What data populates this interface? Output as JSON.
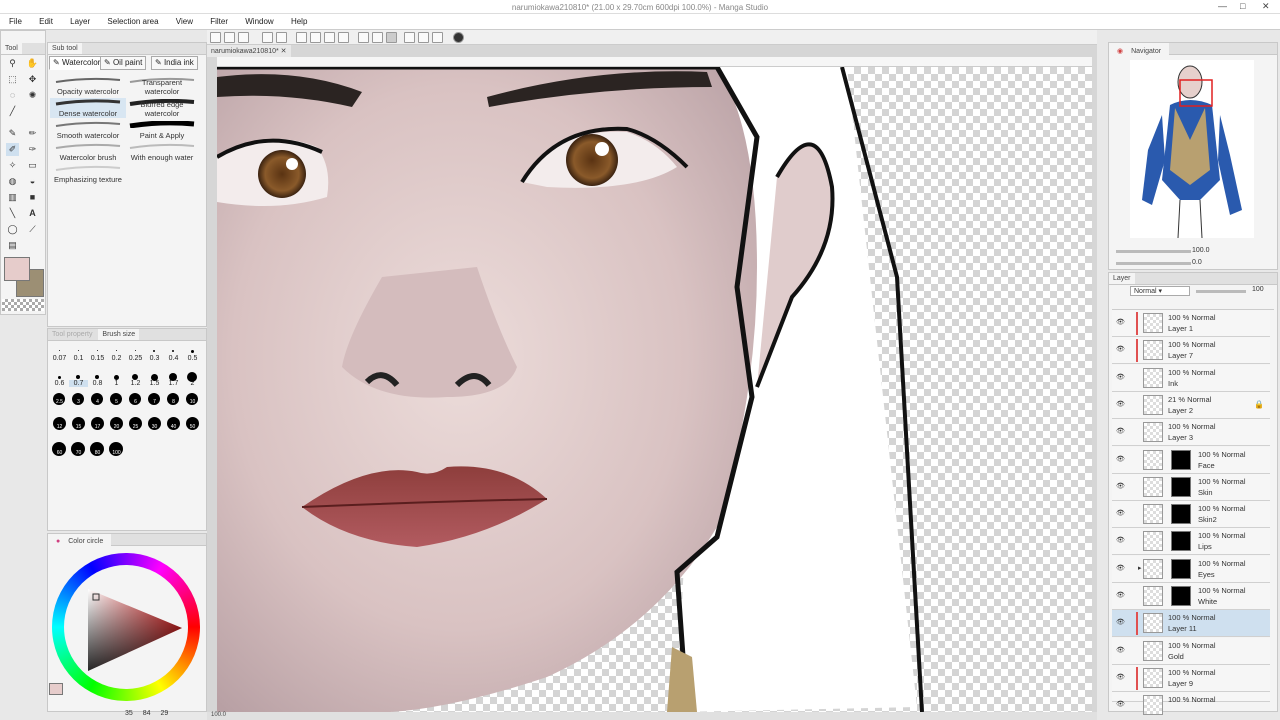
{
  "window": {
    "title": "narumiokawa210810* (21.00 x 29.70cm 600dpi 100.0%) - Manga Studio",
    "controls": [
      "—",
      "□",
      "✕"
    ]
  },
  "menu": [
    "File",
    "Edit",
    "Layer",
    "Selection area",
    "View",
    "Filter",
    "Window",
    "Help"
  ],
  "tool_panel": {
    "tabs": [
      "Tool",
      "Sub tool"
    ]
  },
  "subtool_panel": {
    "tabs": [
      "Watercolor",
      "Oil paint",
      "India ink"
    ],
    "brushes": [
      {
        "label": "Opacity watercolor"
      },
      {
        "label": "Transparent watercolor"
      },
      {
        "label": "Dense watercolor",
        "selected": true
      },
      {
        "label": "Blurred edge watercolor"
      },
      {
        "label": "Smooth watercolor"
      },
      {
        "label": "Paint & Apply"
      },
      {
        "label": "Watercolor brush"
      },
      {
        "label": "With enough water"
      },
      {
        "label": "Emphasizing texture"
      }
    ]
  },
  "brush_size_panel": {
    "tabs": [
      "Tool property",
      "Brush size"
    ],
    "row1": [
      "0.07",
      "0.1",
      "0.15",
      "0.2",
      "0.25",
      "0.3",
      "0.4",
      "0.5"
    ],
    "row2": [
      "0.6",
      "0.7",
      "0.8",
      "1",
      "1.2",
      "1.5",
      "1.7",
      "2"
    ],
    "row3": [
      "2.5",
      "3",
      "4",
      "5",
      "6",
      "7",
      "8",
      "10"
    ],
    "row4": [
      "12",
      "15",
      "17",
      "20",
      "25",
      "30",
      "40",
      "50"
    ],
    "row5": [
      "60",
      "70",
      "80",
      "100"
    ]
  },
  "color_panel": {
    "title": "Color circle",
    "main_color": "#e6cccb",
    "sub_color": "#9c8f74",
    "footer": [
      "35",
      "84",
      "29"
    ]
  },
  "canvas": {
    "tab_label": "narumiokawa210810*",
    "zoom": "100.0"
  },
  "navigator": {
    "title": "Navigator",
    "zoom": "100.0",
    "angle": "0.0"
  },
  "layer_panel": {
    "title": "Layer",
    "blend_mode": "Normal",
    "opacity": "100",
    "layers": [
      {
        "mode": "100 % Normal",
        "name": "Layer 1",
        "red": true
      },
      {
        "mode": "100 % Normal",
        "name": "Layer 7",
        "red": true
      },
      {
        "mode": "100 % Normal",
        "name": "Ink"
      },
      {
        "mode": "21 % Normal",
        "name": "Layer 2",
        "locked": true
      },
      {
        "mode": "100 % Normal",
        "name": "Layer 3"
      },
      {
        "mode": "100 % Normal",
        "name": "Face",
        "mask": true
      },
      {
        "mode": "100 % Normal",
        "name": "Skin",
        "mask": true
      },
      {
        "mode": "100 % Normal",
        "name": "Skin2",
        "mask": true
      },
      {
        "mode": "100 % Normal",
        "name": "Lips",
        "mask": true
      },
      {
        "mode": "100 % Normal",
        "name": "Eyes",
        "mask": true,
        "folder": true
      },
      {
        "mode": "100 % Normal",
        "name": "White",
        "mask": true
      },
      {
        "mode": "100 % Normal",
        "name": "Layer 11",
        "selected": true,
        "red": true
      },
      {
        "mode": "100 % Normal",
        "name": "Gold"
      },
      {
        "mode": "100 % Normal",
        "name": "Layer 9",
        "red": true
      },
      {
        "mode": "100 % Normal",
        "name": ""
      }
    ]
  }
}
